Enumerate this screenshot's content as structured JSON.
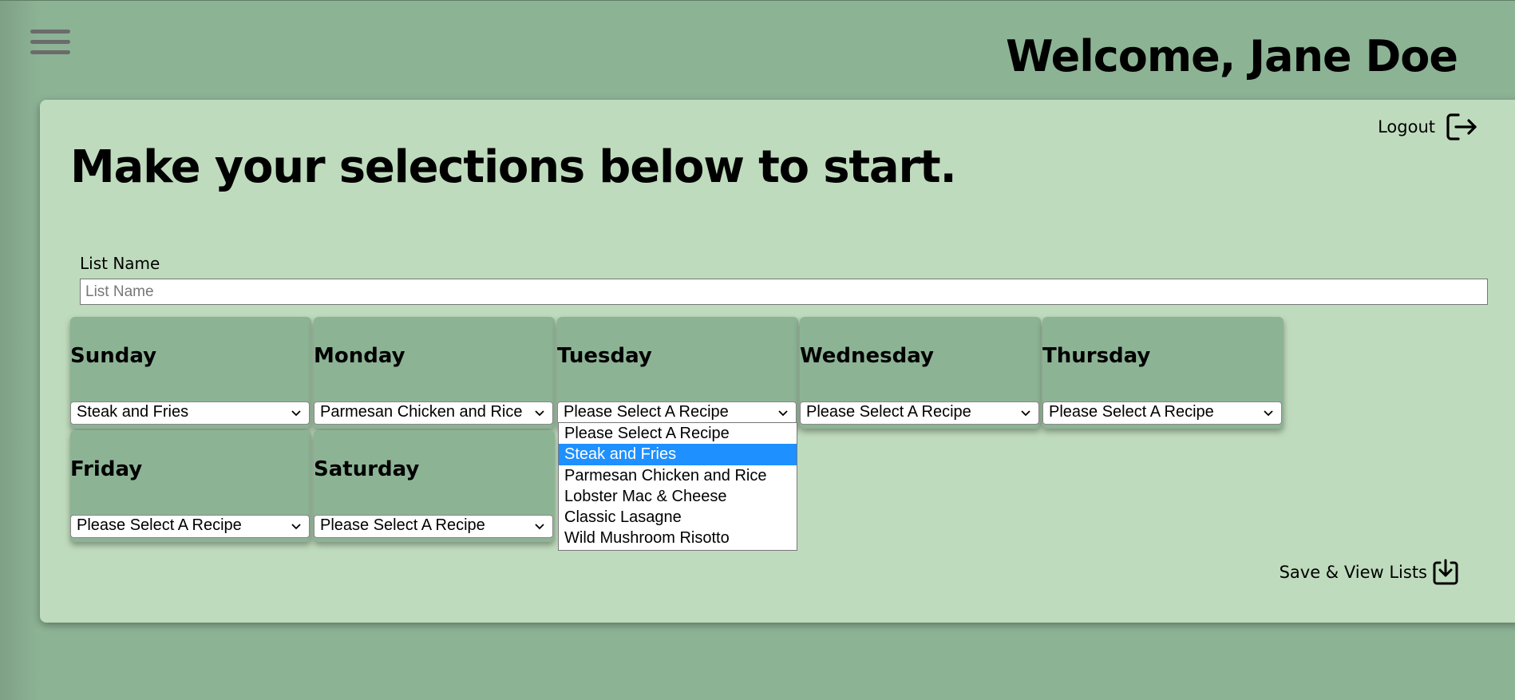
{
  "header": {
    "welcome": "Welcome, Jane Doe"
  },
  "card": {
    "logout_label": "Logout",
    "headline": "Make your selections below to start.",
    "list_name_label": "List Name",
    "list_name_placeholder": "List Name",
    "list_name_value": "",
    "save_label": "Save & View Lists"
  },
  "days": [
    {
      "name": "Sunday",
      "selected": "Steak and Fries"
    },
    {
      "name": "Monday",
      "selected": "Parmesan Chicken and Rice"
    },
    {
      "name": "Tuesday",
      "selected": "Please Select A Recipe"
    },
    {
      "name": "Wednesday",
      "selected": "Please Select A Recipe"
    },
    {
      "name": "Thursday",
      "selected": "Please Select A Recipe"
    },
    {
      "name": "Friday",
      "selected": "Please Select A Recipe"
    },
    {
      "name": "Saturday",
      "selected": "Please Select A Recipe"
    }
  ],
  "dropdown": {
    "open_for": "Tuesday",
    "highlighted": "Steak and Fries",
    "options": [
      "Please Select A Recipe",
      "Steak and Fries",
      "Parmesan Chicken and Rice",
      "Lobster Mac & Cheese",
      "Classic Lasagne",
      "Wild Mushroom Risotto"
    ]
  },
  "colors": {
    "background": "#8db395",
    "card": "#bfdbbd",
    "highlight": "#1e90ff"
  },
  "icons": {
    "menu": "hamburger-menu-icon",
    "logout": "logout-icon",
    "save": "download-tray-icon",
    "select": "chevron-down-icon"
  }
}
